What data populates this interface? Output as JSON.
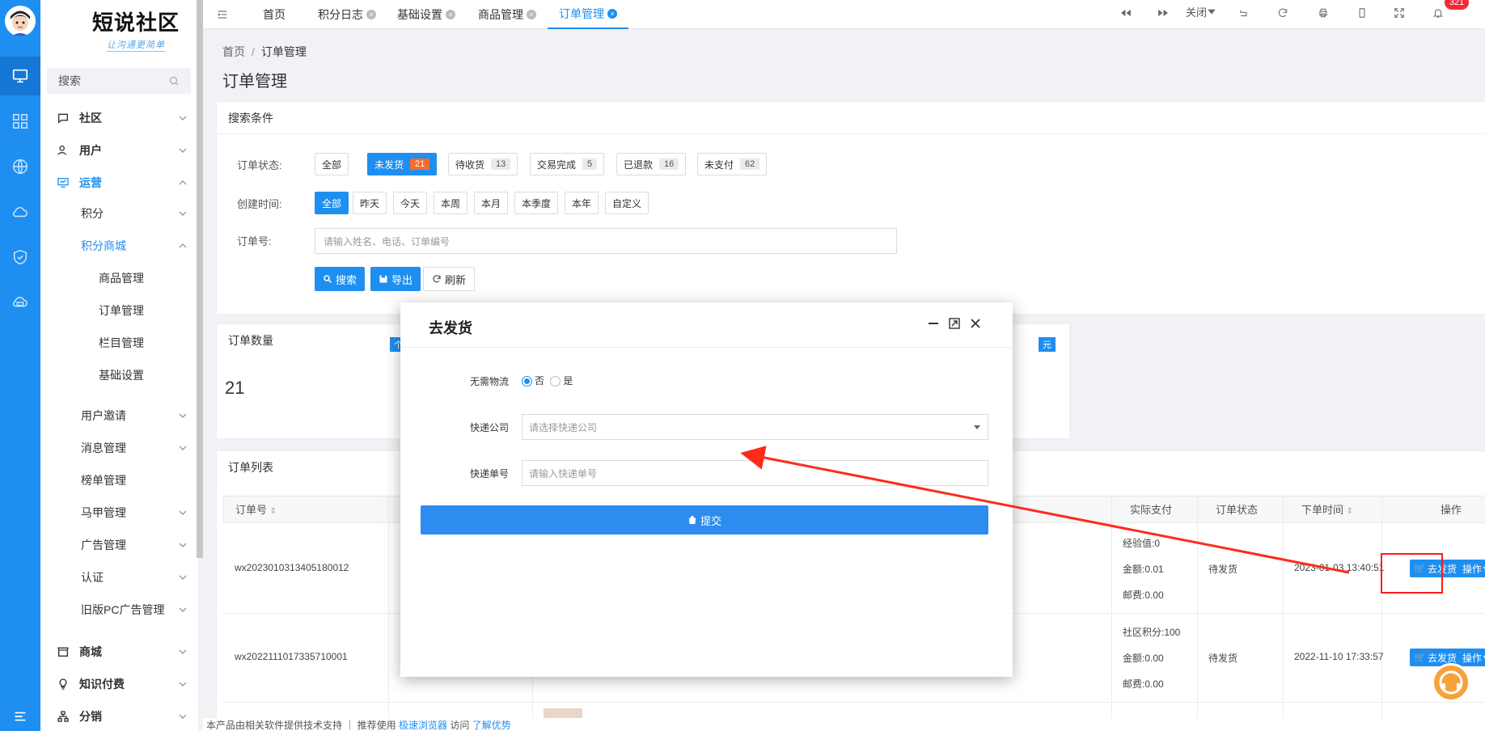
{
  "sidebar": {
    "logo_title": "短说社区",
    "logo_slogan": "让沟通更简单",
    "search_placeholder": "搜索",
    "menu": [
      {
        "label": "社区"
      },
      {
        "label": "用户"
      },
      {
        "label": "运营"
      },
      {
        "label": "积分"
      },
      {
        "label": "积分商城"
      },
      {
        "label": "商品管理"
      },
      {
        "label": "订单管理"
      },
      {
        "label": "栏目管理"
      },
      {
        "label": "基础设置"
      },
      {
        "label": "用户邀请"
      },
      {
        "label": "消息管理"
      },
      {
        "label": "榜单管理"
      },
      {
        "label": "马甲管理"
      },
      {
        "label": "广告管理"
      },
      {
        "label": "认证"
      },
      {
        "label": "旧版PC广告管理"
      },
      {
        "label": "商城"
      },
      {
        "label": "知识付费"
      },
      {
        "label": "分销"
      }
    ]
  },
  "tabs": [
    {
      "label": "首页"
    },
    {
      "label": "积分日志"
    },
    {
      "label": "基础设置"
    },
    {
      "label": "商品管理"
    },
    {
      "label": "订单管理"
    }
  ],
  "topbar": {
    "close_label": "关闭",
    "notifications": "321"
  },
  "breadcrumb": {
    "home": "首页",
    "current": "订单管理"
  },
  "page_title": "订单管理",
  "search": {
    "panel_title": "搜索条件",
    "status_label": "订单状态:",
    "status_options": [
      {
        "label": "全部",
        "count": ""
      },
      {
        "label": "未发货",
        "count": "21"
      },
      {
        "label": "待收货",
        "count": "13"
      },
      {
        "label": "交易完成",
        "count": "5"
      },
      {
        "label": "已退款",
        "count": "16"
      },
      {
        "label": "未支付",
        "count": "62"
      }
    ],
    "time_label": "创建时间:",
    "time_options": [
      "全部",
      "昨天",
      "今天",
      "本周",
      "本月",
      "本季度",
      "本年",
      "自定义"
    ],
    "order_label": "订单号:",
    "order_placeholder": "请输入姓名、电话、订单编号",
    "search_btn": "搜索",
    "export_btn": "导出",
    "refresh_btn": "刷新"
  },
  "stats": {
    "title": "订单数量",
    "value": "21",
    "badge_left": "个",
    "badge_right": "元"
  },
  "orders": {
    "title": "订单列表",
    "columns": [
      "订单号",
      "实际支付",
      "订单状态",
      "下单时间",
      "操作"
    ],
    "rows": [
      {
        "id": "wx2023010313405180012",
        "pay": [
          "经验值:0",
          "金额:0.01",
          "邮费:0.00"
        ],
        "status": "待发货",
        "time": "2023-01-03 13:40:51",
        "ship_btn": "去发货",
        "more_btn": "操作"
      },
      {
        "id": "wx2022111017335710001",
        "pay": [
          "社区积分:100",
          "金额:0.00",
          "邮费:0.00"
        ],
        "status": "待发货",
        "time": "2022-11-10 17:33:57",
        "ship_btn": "去发货",
        "more_btn": "操作"
      }
    ]
  },
  "dialog": {
    "title": "去发货",
    "no_logistics_label": "无需物流",
    "option_no": "否",
    "option_yes": "是",
    "company_label": "快递公司",
    "company_placeholder": "请选择快递公司",
    "tracking_label": "快递单号",
    "tracking_placeholder": "请输入快递单号",
    "submit": "提交"
  },
  "footer": {
    "text": "本产品由相关软件提供技术支持 ｜ 推荐使用",
    "browser_link": "极速浏览器",
    "tail": "访问",
    "learn_link": "了解优势"
  }
}
